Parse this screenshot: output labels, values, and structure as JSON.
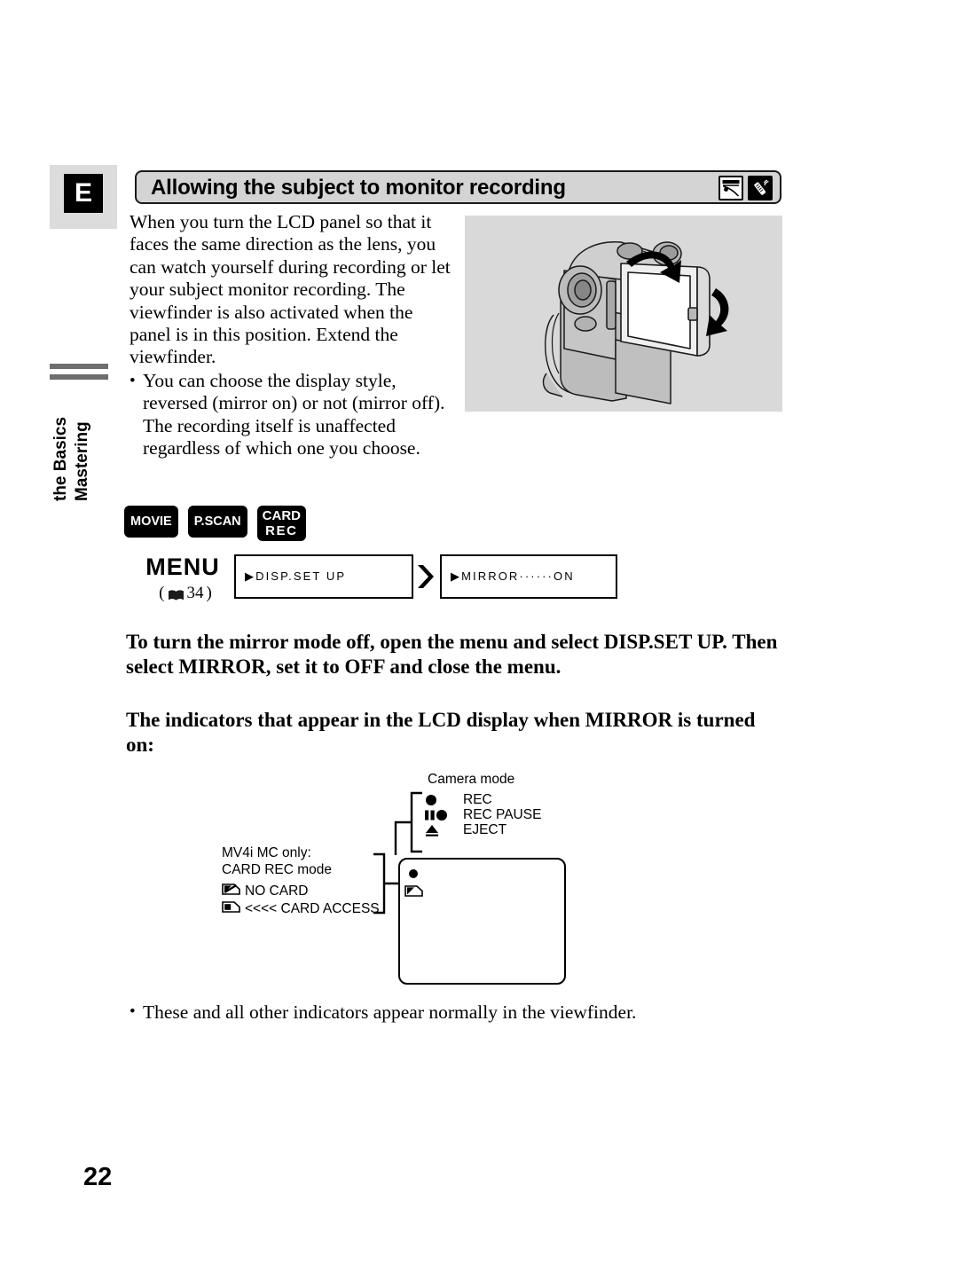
{
  "page": {
    "number": "22",
    "side_tab_letter": "E",
    "chapter_title_line1": "Mastering",
    "chapter_title_line2": "the Basics"
  },
  "section": {
    "title": "Allowing the subject to monitor recording",
    "icons": [
      {
        "name": "lcd-panel-icon",
        "style": "outline"
      },
      {
        "name": "remote-control-icon",
        "style": "inverted"
      }
    ]
  },
  "body": {
    "intro_paragraph": "When you turn the LCD panel so that it faces the same direction as the lens, you can watch yourself during recording or let your subject monitor recording. The viewfinder is also activated when the panel is in this position. Extend the viewfinder.",
    "bullet_display_style": "You can choose the display style, reversed (mirror on) or not (mirror off). The recording itself is unaffected regardless of which one you choose.",
    "bullet_marker": "•",
    "closing_bullet": "These and all other indicators appear normally in the viewfinder."
  },
  "figure": {
    "camcorder_alt": "Camcorder with LCD panel rotated to face the lens direction"
  },
  "mode_badges": [
    {
      "name": "movie",
      "line1": "MOVIE",
      "line2": ""
    },
    {
      "name": "p-scan",
      "line1": "P.SCAN",
      "line2": ""
    },
    {
      "name": "card-rec",
      "line1": "CARD",
      "line2": "REC"
    }
  ],
  "menu": {
    "label": "MENU",
    "reference_open": "(",
    "reference_page": "34",
    "reference_close": ")",
    "arrow_glyph": "❯❯",
    "screens": [
      {
        "name": "disp-set-up",
        "text": "▶DISP.SET UP"
      },
      {
        "name": "mirror-on",
        "text": "▶MIRROR······ON"
      }
    ]
  },
  "instructions": {
    "mirror_off": "To turn the mirror mode off, open the menu and select DISP.SET UP. Then select MIRROR, set it to OFF and close the menu.",
    "indicators_heading": "The indicators that appear in the LCD display when MIRROR is turned on:"
  },
  "indicator_diagram": {
    "camera_mode_label": "Camera mode",
    "camera_mode_rows": [
      {
        "glyph": "record-dot-icon",
        "label": "REC"
      },
      {
        "glyph": "record-pause-icon",
        "label": "REC PAUSE"
      },
      {
        "glyph": "eject-triangle-icon",
        "label": "EJECT"
      }
    ],
    "card_note_line1": "MV4i MC only:",
    "card_note_line2": "CARD REC mode",
    "card_rows": [
      {
        "glyph": "no-card-icon",
        "label": "NO CARD"
      },
      {
        "glyph": "card-access-icon",
        "label": "<<<< CARD ACCESS"
      }
    ],
    "lcd_screen_name": "lcd-display-frame"
  },
  "colors": {
    "header_bar_bg": "#d4d4d4",
    "side_tab_panel_bg": "#dcdcdc",
    "figure_bg": "#d9d9d9",
    "rule_gray": "#6e6e6e",
    "badge_bg": "#000000",
    "ink": "#000000"
  }
}
